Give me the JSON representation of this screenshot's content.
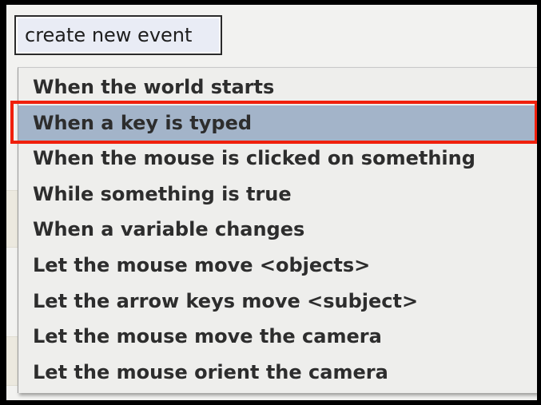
{
  "button": {
    "label": "create new event"
  },
  "menu": {
    "items": [
      {
        "label": "When the world starts",
        "selected": false
      },
      {
        "label": "When a key is typed",
        "selected": true
      },
      {
        "label": "When the mouse is clicked on something",
        "selected": false
      },
      {
        "label": "While something is true",
        "selected": false
      },
      {
        "label": "When a variable changes",
        "selected": false
      },
      {
        "label": "Let the mouse move <objects>",
        "selected": false
      },
      {
        "label": "Let the arrow keys move <subject>",
        "selected": false
      },
      {
        "label": "Let the mouse move the camera",
        "selected": false
      },
      {
        "label": "Let the mouse orient the camera",
        "selected": false
      }
    ]
  },
  "colors": {
    "selected_bg": "#a3b4c9",
    "highlight_border": "#f0200c"
  }
}
